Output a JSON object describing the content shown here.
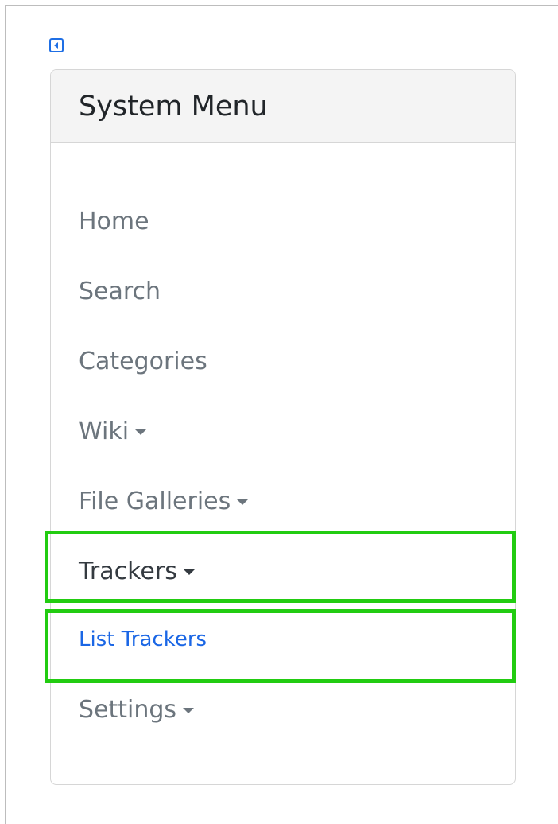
{
  "sidebar": {
    "title": "System Menu",
    "collapse_icon": "caret-left-square-icon",
    "items": [
      {
        "label": "Home",
        "has_caret": false
      },
      {
        "label": "Search",
        "has_caret": false
      },
      {
        "label": "Categories",
        "has_caret": false
      },
      {
        "label": "Wiki",
        "has_caret": true
      },
      {
        "label": "File Galleries",
        "has_caret": true
      },
      {
        "label": "Trackers",
        "has_caret": true,
        "expanded": true
      },
      {
        "label": "Settings",
        "has_caret": true
      }
    ],
    "subitems": {
      "trackers": [
        {
          "label": "List Trackers"
        }
      ]
    }
  },
  "colors": {
    "link": "#1a66e5",
    "text_muted": "#6c757d",
    "highlight": "#22cc11",
    "toggle": "#1f6fe5"
  }
}
